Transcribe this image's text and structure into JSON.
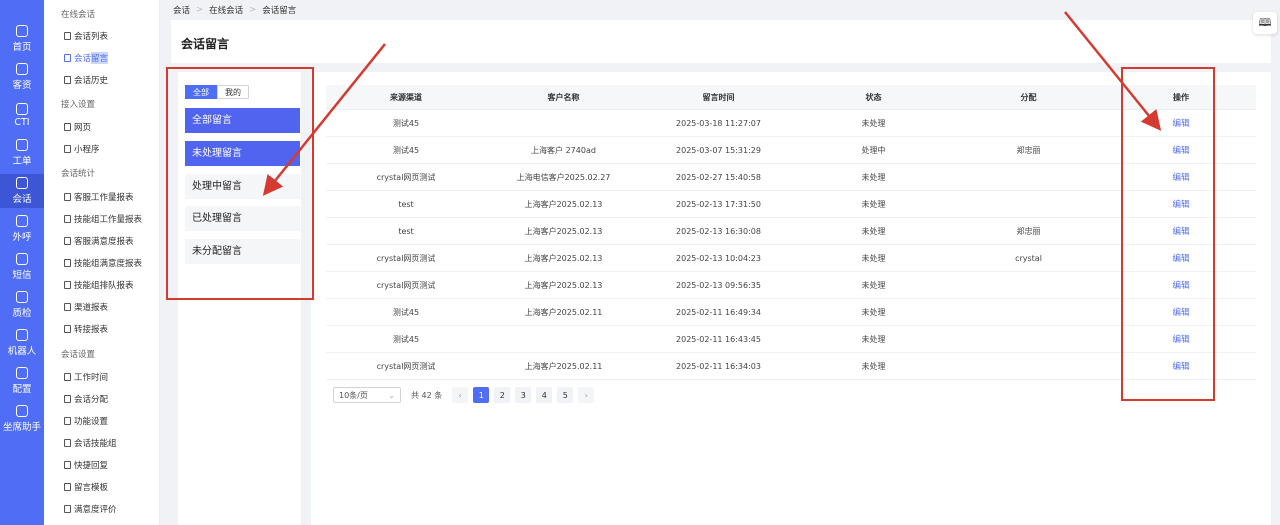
{
  "rail": [
    {
      "label": "首页",
      "icon": "home-icon"
    },
    {
      "label": "客资",
      "icon": "users-icon"
    },
    {
      "label": "CTI",
      "icon": "cti-icon"
    },
    {
      "label": "工单",
      "icon": "ticket-icon"
    },
    {
      "label": "会话",
      "icon": "chat-icon",
      "active": true
    },
    {
      "label": "外呼",
      "icon": "phone-icon"
    },
    {
      "label": "短信",
      "icon": "sms-icon"
    },
    {
      "label": "质检",
      "icon": "inspect-icon"
    },
    {
      "label": "机器人",
      "icon": "robot-icon"
    },
    {
      "label": "配置",
      "icon": "settings-icon"
    },
    {
      "label": "坐席助手",
      "icon": "assistant-icon"
    }
  ],
  "submenu": {
    "group_online": "在线会话",
    "item_list": "会话列表",
    "item_msg_a": "会话",
    "item_msg_b": "留言",
    "item_history": "会话历史",
    "group_access": "接入设置",
    "item_web": "网页",
    "item_mini": "小程序",
    "group_stats": "会话统计",
    "item_s1": "客服工作量报表",
    "item_s2": "技能组工作量报表",
    "item_s3": "客服满意度报表",
    "item_s4": "技能组满意度报表",
    "item_s5": "技能组排队报表",
    "item_s6": "渠道报表",
    "item_s7": "转接报表",
    "group_settings": "会话设置",
    "item_c1": "工作时间",
    "item_c2": "会话分配",
    "item_c3": "功能设置",
    "item_c4": "会话技能组",
    "item_c5": "快捷回复",
    "item_c6": "留言模板",
    "item_c7": "满意度评价"
  },
  "breadcrumb": [
    "会话",
    "在线会话",
    "会话留言"
  ],
  "page_title": "会话留言",
  "filter": {
    "seg_all": "全部",
    "seg_mine": "我的",
    "items": [
      "全部留言",
      "未处理留言",
      "处理中留言",
      "已处理留言",
      "未分配留言"
    ]
  },
  "table": {
    "headers": [
      "来源渠道",
      "客户名称",
      "留言时间",
      "状态",
      "分配",
      "操作"
    ],
    "edit_label": "编辑",
    "rows": [
      [
        "测试45",
        "",
        "2025-03-18 11:27:07",
        "未处理",
        ""
      ],
      [
        "测试45",
        "上海客户 2740ad",
        "2025-03-07 15:31:29",
        "处理中",
        "郑忠丽"
      ],
      [
        "crystal网页测试",
        "上海电信客户2025.02.27",
        "2025-02-27 15:40:58",
        "未处理",
        ""
      ],
      [
        "test",
        "上海客户2025.02.13",
        "2025-02-13 17:31:50",
        "未处理",
        ""
      ],
      [
        "test",
        "上海客户2025.02.13",
        "2025-02-13 16:30:08",
        "未处理",
        "郑忠丽"
      ],
      [
        "crystal网页测试",
        "上海客户2025.02.13",
        "2025-02-13 10:04:23",
        "未处理",
        "crystal"
      ],
      [
        "crystal网页测试",
        "上海客户2025.02.13",
        "2025-02-13 09:56:35",
        "未处理",
        ""
      ],
      [
        "测试45",
        "上海客户2025.02.11",
        "2025-02-11 16:49:34",
        "未处理",
        ""
      ],
      [
        "测试45",
        "",
        "2025-02-11 16:43:45",
        "未处理",
        ""
      ],
      [
        "crystal网页测试",
        "上海客户2025.02.11",
        "2025-02-11 16:34:03",
        "未处理",
        ""
      ]
    ]
  },
  "pager": {
    "page_size": "10条/页",
    "total": "共 42 条",
    "pages": [
      "1",
      "2",
      "3",
      "4",
      "5"
    ],
    "prev": "‹",
    "next": "›",
    "caret": "⌄"
  },
  "book_icon_glyph": "🕮",
  "colors": {
    "accent": "#4f6df5",
    "annotation": "#d43a2f"
  }
}
